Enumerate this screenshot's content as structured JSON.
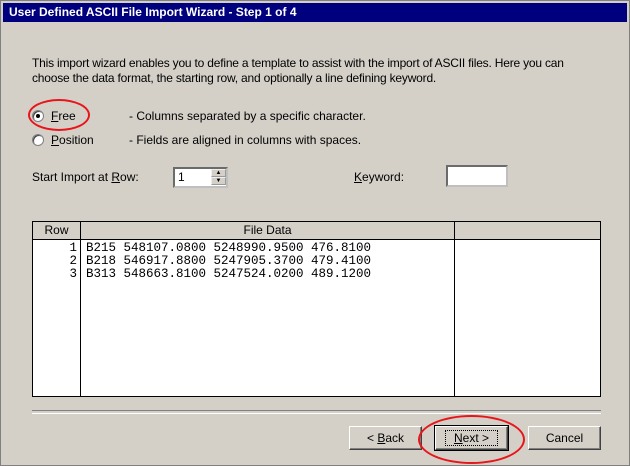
{
  "window": {
    "title": "User Defined ASCII File Import Wizard - Step 1 of 4"
  },
  "intro": {
    "line1": "This import wizard enables you to define a template to assist with the import of ASCII files.  Here you can",
    "line2": "choose the data format, the starting row, and optionally a line defining keyword."
  },
  "format": {
    "selected": "Free",
    "free": {
      "label_u": "F",
      "label_rest": "ree",
      "description": "- Columns separated by a specific character."
    },
    "position": {
      "label_u": "P",
      "label_rest": "osition",
      "description": "- Fields are aligned in columns with spaces."
    }
  },
  "start_row": {
    "label_pre": "Start Import at ",
    "label_u": "R",
    "label_post": "ow:",
    "value": "1"
  },
  "keyword": {
    "label_u": "K",
    "label_post": "eyword:",
    "value": ""
  },
  "grid": {
    "columns": [
      "Row",
      "File Data",
      ""
    ],
    "rows": [
      {
        "num": "1",
        "data": "B215 548107.0800 5248990.9500 476.8100"
      },
      {
        "num": "2",
        "data": "B218 546917.8800 5247905.3700 479.4100"
      },
      {
        "num": "3",
        "data": "B313 548663.8100 5247524.0200 489.1200"
      }
    ]
  },
  "buttons": {
    "back": {
      "pre": "< ",
      "u": "B",
      "post": "ack"
    },
    "next": {
      "u": "N",
      "post": "ext >"
    },
    "cancel": "Cancel"
  },
  "colors": {
    "title_bar": "#00007e",
    "dialog_face": "#d4d0c8",
    "annotation_circle": "#e8151b"
  }
}
